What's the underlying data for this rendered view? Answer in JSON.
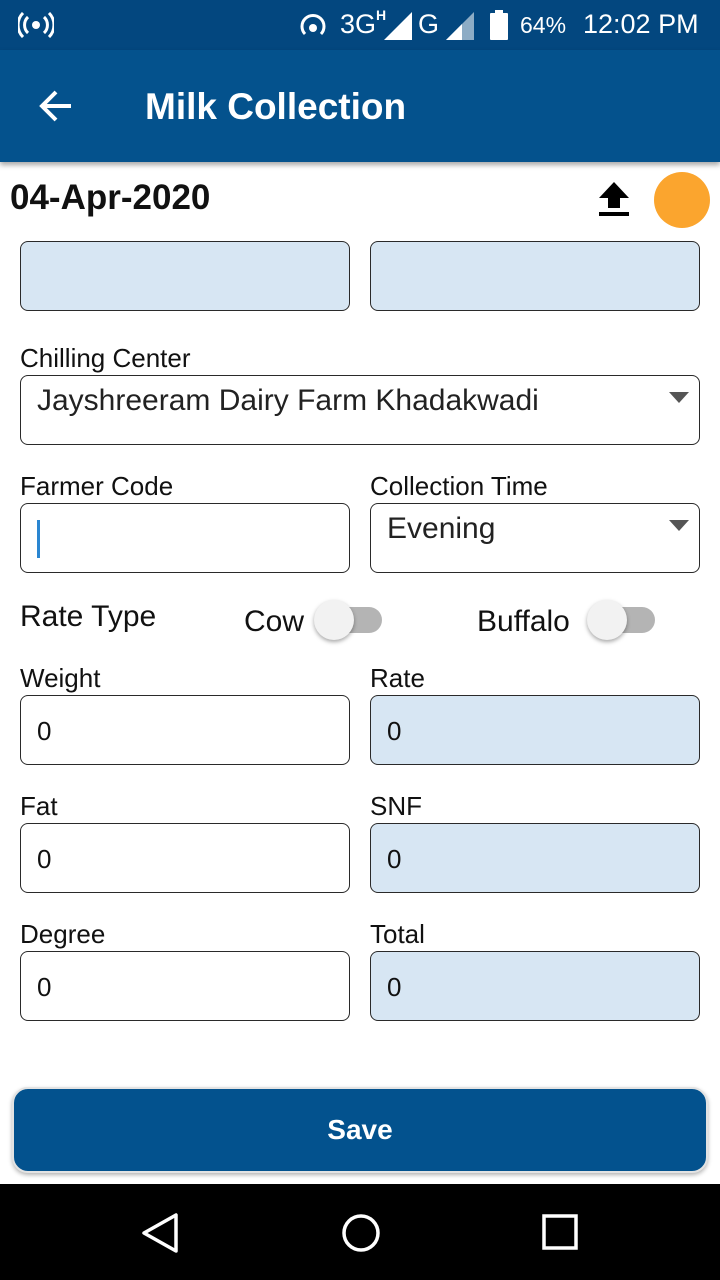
{
  "status_bar": {
    "network_type": "3G",
    "network_superscript": "H",
    "second_network": "G",
    "battery_percent": "64%",
    "time": "12:02 PM",
    "icons": [
      "hotspot-icon",
      "wifi-calling-icon",
      "signal-icon",
      "signal-icon",
      "battery-icon"
    ]
  },
  "app_bar": {
    "title": "Milk Collection",
    "back_icon": "arrow-back-icon"
  },
  "header": {
    "date": "04-Apr-2020",
    "upload_icon": "upload-icon",
    "status_dot_color": "#fba52e"
  },
  "form": {
    "top_field_1_value": "",
    "top_field_2_value": "",
    "chilling_center": {
      "label": "Chilling Center",
      "value": "Jayshreeram Dairy Farm Khadakwadi"
    },
    "farmer_code": {
      "label": "Farmer Code",
      "value": ""
    },
    "collection_time": {
      "label": "Collection Time",
      "value": "Evening"
    },
    "rate_type": {
      "label": "Rate Type",
      "cow_label": "Cow",
      "cow_on": false,
      "buffalo_label": "Buffalo",
      "buffalo_on": false
    },
    "weight": {
      "label": "Weight",
      "value": "0"
    },
    "rate": {
      "label": "Rate",
      "value": "0"
    },
    "fat": {
      "label": "Fat",
      "value": "0"
    },
    "snf": {
      "label": "SNF",
      "value": "0"
    },
    "degree": {
      "label": "Degree",
      "value": "0"
    },
    "total": {
      "label": "Total",
      "value": "0"
    }
  },
  "actions": {
    "save_label": "Save"
  },
  "nav_bar": {
    "icons": [
      "back-triangle-icon",
      "home-circle-icon",
      "recents-square-icon"
    ]
  },
  "colors": {
    "primary": "#04528d",
    "status_bar": "#03477f",
    "readonly_field": "#d7e6f3",
    "accent_orange": "#fba52e"
  }
}
